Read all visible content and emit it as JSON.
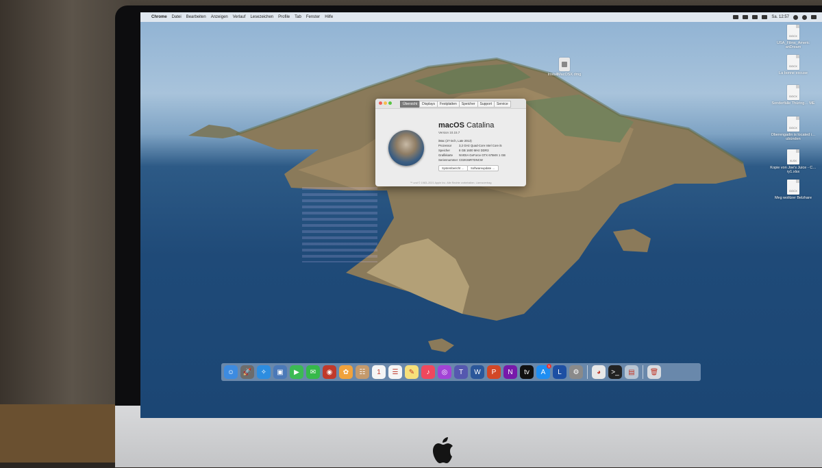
{
  "menubar": {
    "items": [
      "Chrome",
      "Datei",
      "Bearbeiten",
      "Anzeigen",
      "Verlauf",
      "Lesezeichen",
      "Profile",
      "Tab",
      "Fenster",
      "Hilfe"
    ],
    "clock": "Sa. 12:57"
  },
  "desktop": {
    "right_icons": [
      {
        "label": "USA_Films_Americ anDream",
        "type": "DOCX"
      },
      {
        "label": "La bonne excuse",
        "type": "DOCX"
      },
      {
        "label": "Sonderfälle Thüring… ME",
        "type": "DOCX"
      },
      {
        "label": "Oberengadin is located i…ubünden",
        "type": "DOCX"
      },
      {
        "label": "Kopie von Joe's Juice - C…ry1.xlsx",
        "type": "XLSX"
      },
      {
        "label": "Meg wolitzer Belzhare",
        "type": "DOCX"
      }
    ],
    "dmg_icon": {
      "label": "InstallMacOSX.dmg"
    }
  },
  "about": {
    "tabs": [
      "Übersicht",
      "Displays",
      "Festplatten",
      "Speicher",
      "Support",
      "Service"
    ],
    "active_tab": "Übersicht",
    "os_name_prefix": "macOS",
    "os_name_suffix": "Catalina",
    "version": "Version 10.15.7",
    "model": "iMac (27-inch, Late 2013)",
    "specs": [
      {
        "key": "Prozessor",
        "value": "3,2 GHz Quad-Core Intel Core i5"
      },
      {
        "key": "Speicher",
        "value": "8 GB 1600 MHz DDR3"
      },
      {
        "key": "Grafikkarte",
        "value": "NVIDIA GeForce GTX 675MX 1 GB"
      },
      {
        "key": "Seriennummer",
        "value": "C02KS6R7DNCW"
      }
    ],
    "buttons": {
      "system_report": "Systembericht …",
      "software_update": "Softwareupdate …"
    },
    "copyright": "™ und © 1983–2021 Apple Inc. Alle Rechte vorbehalten. Lizenzvertrag"
  },
  "dock": {
    "apps": [
      {
        "name": "finder",
        "color": "#3d8be0",
        "glyph": "☺"
      },
      {
        "name": "launchpad",
        "color": "#6c6c6c",
        "glyph": "🚀"
      },
      {
        "name": "safari",
        "color": "#2d8de0",
        "glyph": "✧"
      },
      {
        "name": "preview",
        "color": "#4b79b8",
        "glyph": "▣"
      },
      {
        "name": "facetime",
        "color": "#3cba54",
        "glyph": "▶"
      },
      {
        "name": "messages",
        "color": "#36b94a",
        "glyph": "✉"
      },
      {
        "name": "photo-booth",
        "color": "#c0392b",
        "glyph": "◉"
      },
      {
        "name": "photos",
        "color": "#f0a23c",
        "glyph": "✿"
      },
      {
        "name": "contacts",
        "color": "#c49a6c",
        "glyph": "☷"
      },
      {
        "name": "calendar",
        "color": "#f5f5f5",
        "glyph": "1"
      },
      {
        "name": "reminders",
        "color": "#f5f5f5",
        "glyph": "☰"
      },
      {
        "name": "notes",
        "color": "#f7e07a",
        "glyph": "✎"
      },
      {
        "name": "music",
        "color": "#f0485d",
        "glyph": "♪"
      },
      {
        "name": "podcasts",
        "color": "#a243d6",
        "glyph": "◎"
      },
      {
        "name": "teams",
        "color": "#5558af",
        "glyph": "T"
      },
      {
        "name": "word",
        "color": "#2b579a",
        "glyph": "W"
      },
      {
        "name": "powerpoint",
        "color": "#d24726",
        "glyph": "P"
      },
      {
        "name": "onenote",
        "color": "#7719aa",
        "glyph": "N"
      },
      {
        "name": "apple-tv",
        "color": "#111111",
        "glyph": "tv"
      },
      {
        "name": "app-store",
        "color": "#1e8ef2",
        "glyph": "A",
        "badge": "1"
      },
      {
        "name": "langenscheidt",
        "color": "#1d4fa3",
        "glyph": "L"
      },
      {
        "name": "system-preferences",
        "color": "#8a8a8a",
        "glyph": "⚙"
      }
    ],
    "recent": [
      {
        "name": "chrome",
        "color": "#e8e8e8",
        "glyph": "◕"
      },
      {
        "name": "terminal",
        "color": "#222222",
        "glyph": ">_"
      },
      {
        "name": "image-capture",
        "color": "#b8c5d3",
        "glyph": "▤"
      }
    ],
    "trash": {
      "name": "trash",
      "color": "#d7dbe0",
      "glyph": "🗑"
    }
  }
}
